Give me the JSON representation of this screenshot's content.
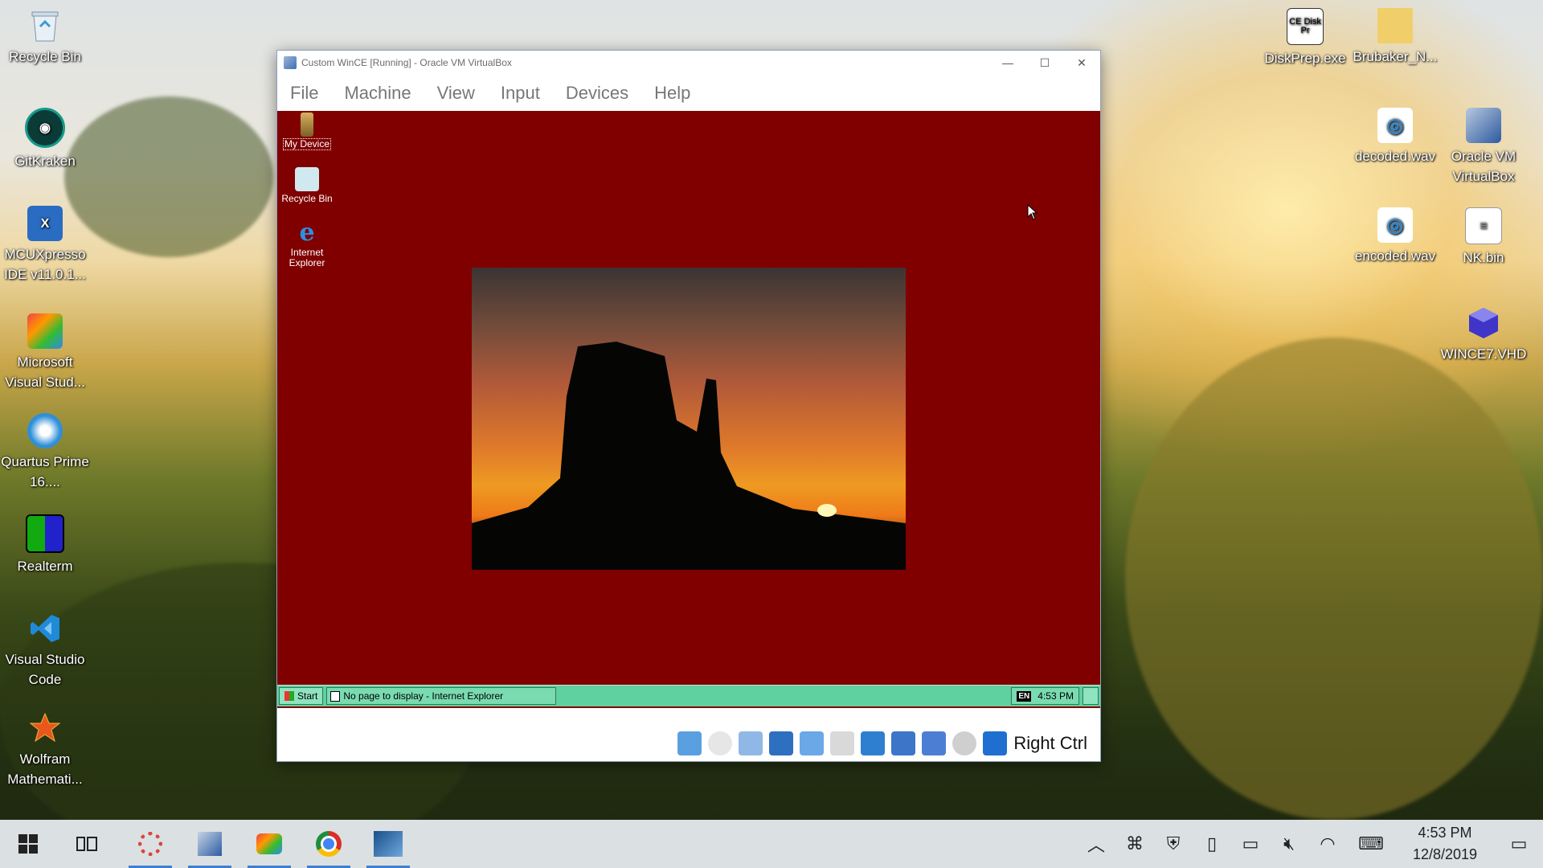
{
  "desktop": {
    "left_icons": [
      {
        "label": "Recycle Bin",
        "icon": "recycle-bin-icon"
      },
      {
        "label": "GitKraken",
        "icon": "gitkraken-icon"
      },
      {
        "label": "MCUXpresso IDE v11.0.1...",
        "icon": "mcuxpresso-icon"
      },
      {
        "label": "Microsoft Visual Stud...",
        "icon": "visual-studio-icon"
      },
      {
        "label": "Quartus Prime 16....",
        "icon": "quartus-icon"
      },
      {
        "label": "Realterm",
        "icon": "realterm-icon"
      },
      {
        "label": "Visual Studio Code",
        "icon": "vscode-icon"
      },
      {
        "label": "Wolfram Mathemati...",
        "icon": "mathematica-icon"
      }
    ],
    "right_icons": [
      {
        "label": "DiskPrep.exe",
        "icon": "diskprep-icon",
        "badge": "CE Disk Pr"
      },
      {
        "label": "Brubaker_N...",
        "icon": "folder-zip-icon"
      },
      {
        "label": "decoded.wav",
        "icon": "audio-file-icon"
      },
      {
        "label": "Oracle VM VirtualBox",
        "icon": "virtualbox-icon"
      },
      {
        "label": "encoded.wav",
        "icon": "audio-file-icon"
      },
      {
        "label": "NK.bin",
        "icon": "file-icon"
      },
      {
        "label": "WINCE7.VHD",
        "icon": "vhd-icon"
      }
    ]
  },
  "vbox": {
    "title": "Custom WinCE [Running] - Oracle VM VirtualBox",
    "menu": [
      "File",
      "Machine",
      "View",
      "Input",
      "Devices",
      "Help"
    ],
    "host_key": "Right Ctrl"
  },
  "guest": {
    "icons": [
      {
        "label": "My Device"
      },
      {
        "label": "Recycle Bin"
      },
      {
        "label": "Internet Explorer"
      }
    ],
    "taskbar": {
      "start": "Start",
      "task": "No page to display - Internet Explorer",
      "lang": "EN",
      "time": "4:53 PM"
    }
  },
  "taskbar": {
    "time": "4:53 PM",
    "date": "12/8/2019"
  },
  "colors": {
    "guest_background": "#800000",
    "ce_taskbar": "#5fd0a0",
    "accent": "#3b7fd0"
  }
}
